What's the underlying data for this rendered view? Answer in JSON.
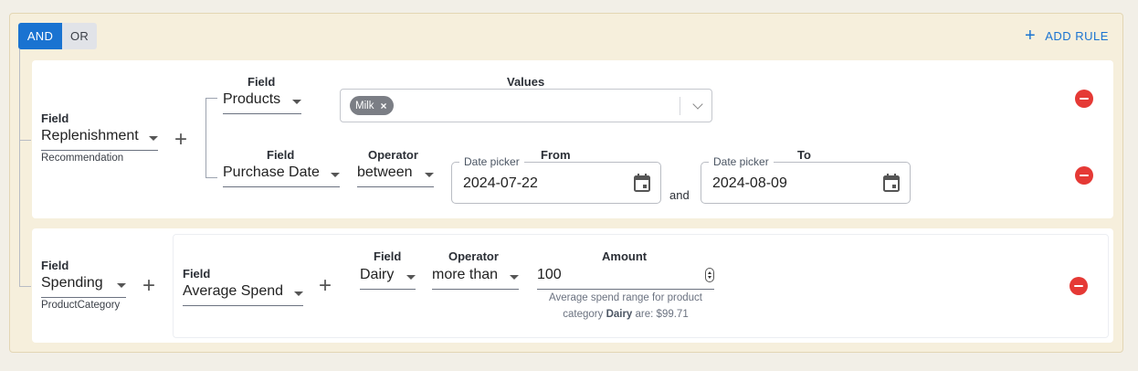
{
  "toolbar": {
    "and_label": "AND",
    "or_label": "OR",
    "add_rule_label": "ADD RULE"
  },
  "rule1": {
    "field_label": "Field",
    "field_value": "Replenishment",
    "field_sub": "Recommendation",
    "sub1": {
      "field_label": "Field",
      "field_value": "Products",
      "values_label": "Values",
      "chips": [
        "Milk"
      ]
    },
    "sub2": {
      "field_label": "Field",
      "field_value": "Purchase Date",
      "operator_label": "Operator",
      "operator_value": "between",
      "from_label": "From",
      "from_legend": "Date picker",
      "from_value": "2024-07-22",
      "and_text": "and",
      "to_label": "To",
      "to_legend": "Date picker",
      "to_value": "2024-08-09"
    }
  },
  "rule2": {
    "field_label": "Field",
    "field_value": "Spending",
    "field_sub": "ProductCategory",
    "sub": {
      "field_label": "Field",
      "field_value": "Average Spend",
      "cat_field_label": "Field",
      "cat_field_value": "Dairy",
      "operator_label": "Operator",
      "operator_value": "more than",
      "amount_label": "Amount",
      "amount_value": "100",
      "helper_line1": "Average spend range for product",
      "helper_pre": "category ",
      "helper_bold": "Dairy",
      "helper_post": " are: $99.71"
    }
  },
  "icons": {
    "add": "plus-icon",
    "remove": "remove-circle-icon",
    "calendar": "calendar-icon",
    "dropdown": "caret-down-icon"
  },
  "colors": {
    "accent": "#1a73d1",
    "danger": "#e53935",
    "panel": "#f6efdc"
  }
}
